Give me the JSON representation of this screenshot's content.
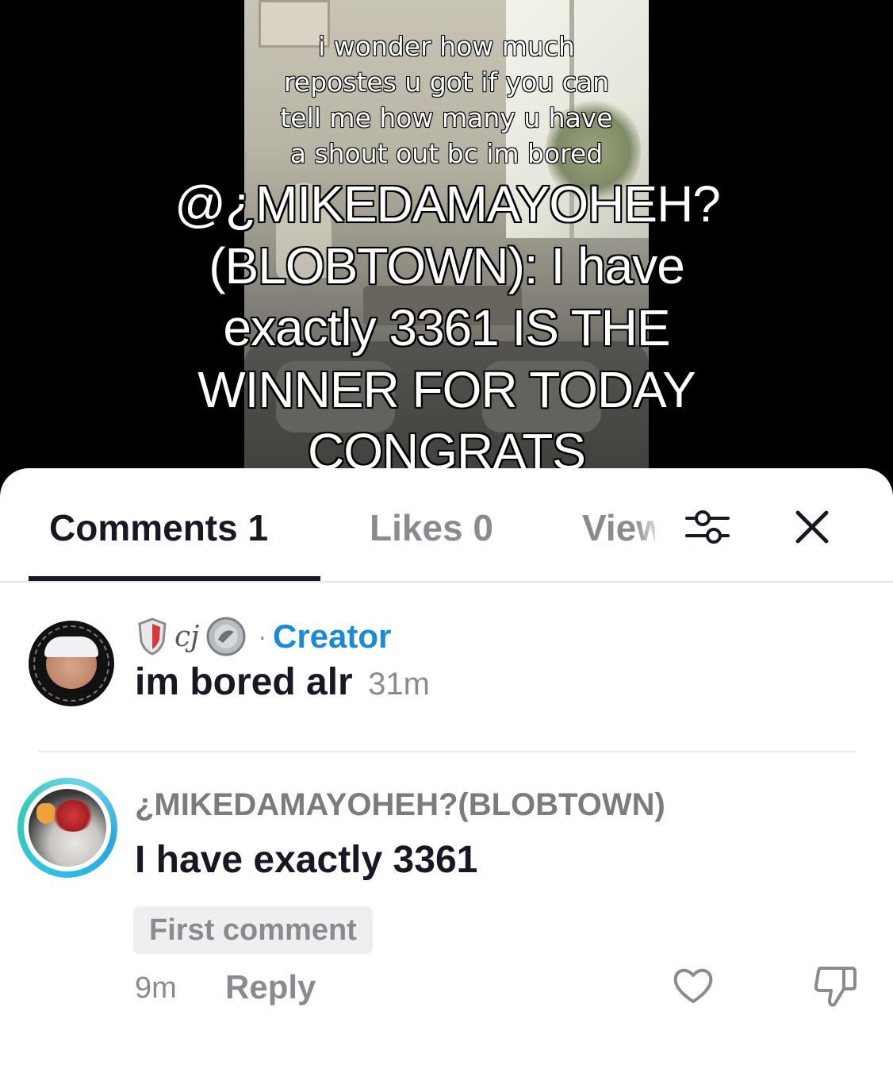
{
  "video": {
    "overlay_small": "i wonder how much\nrepostes u got if you can\ntell me how many u have\na shout out bc im bored",
    "overlay_big": "@¿MIKEDAMAYOHEH?(BLOBTOWN): I have exactly 3361   IS THE WINNER FOR TODAY CONGRATS"
  },
  "tabs": {
    "comments": "Comments 1",
    "likes": "Likes 0",
    "views": "Views"
  },
  "icons": {
    "filter": "filter-sliders-icon",
    "close": "close-icon",
    "heart": "heart-outline-icon",
    "dislike": "thumbs-down-icon"
  },
  "comment_1": {
    "username": "cj",
    "role": "Creator",
    "separator": "·",
    "text": "im bored alr",
    "time": "31m"
  },
  "comment_2": {
    "username": "¿MIKEDAMAYOHEH?(BLOBTOWN)",
    "text": "I have exactly 3361",
    "badge": "First comment",
    "time": "9m",
    "reply_label": "Reply"
  },
  "colors": {
    "creator_blue": "#1a8ad6",
    "text_primary": "#161823",
    "text_secondary": "#8a8b91",
    "story_ring": "#2ec3e6"
  }
}
